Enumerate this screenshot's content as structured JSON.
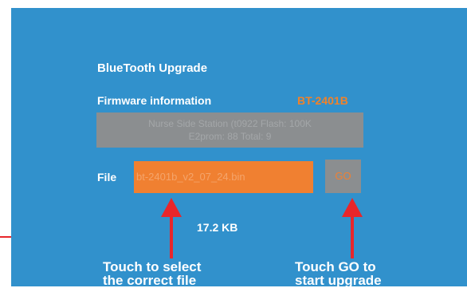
{
  "colors": {
    "background": "#3191cc",
    "accent": "#f08031",
    "panel_gray": "#8b8e90",
    "callout_red": "#e8262b"
  },
  "screen": {
    "title": "BlueTooth Upgrade",
    "firmware_label": "Firmware information",
    "model": "BT-2401B",
    "info_line1": "Nurse Side Station (t0922 Flash: 100K",
    "info_line2": "E2prom: 88 Total: 9",
    "file_label": "File",
    "file_value": "bt-2401b_v2_07_24.bin",
    "go_label": "GO",
    "file_size": "17.2 KB"
  },
  "annotations": {
    "select_caption_line1": "Touch to select",
    "select_caption_line2": "the correct file",
    "go_caption_line1": "Touch GO to",
    "go_caption_line2": "start upgrade"
  }
}
